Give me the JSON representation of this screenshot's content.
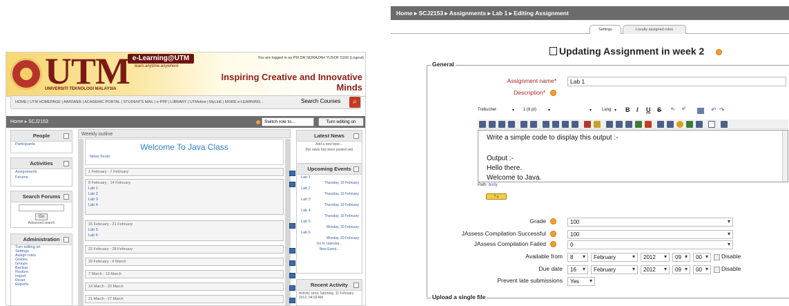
{
  "left": {
    "brand": {
      "name": "UTM",
      "university": "UNIVERSITI TEKNOLOGI MALAYSIA",
      "elearning": "e-Learning@UTM",
      "tagline": "learn.anytime.anywhere",
      "slogan": "Inspiring Creative and Innovative Minds",
      "logged_in": "You are logged in as PM DR NORAZAH YUSOF 5160 (Logout)"
    },
    "nav": {
      "links": "HOME | UTM HOMEPAGE | AIMSWEB | ACADEMIC PORTAL | STUDENTS MAIL | e-PPP | LIBRARY | UTMotion | MyLinE | MORE e-LEARNING...",
      "search_label": "Search Courses"
    },
    "breadcrumb": "Home ▸ SCJ2153",
    "switch_role": "Switch role to...",
    "turn_editing": "Turn editing on",
    "people": {
      "title": "People",
      "items": [
        "Participants"
      ]
    },
    "activities": {
      "title": "Activities",
      "items": [
        "Assignments",
        "Forums"
      ]
    },
    "search_forums": {
      "title": "Search Forums",
      "go": "Go",
      "advanced": "Advanced search"
    },
    "administration": {
      "title": "Administration",
      "items": [
        "Turn editing on",
        "Settings",
        "Assign roles",
        "Grades",
        "Groups",
        "Backup",
        "Restore",
        "Import",
        "Reset",
        "Reports"
      ]
    },
    "outline": {
      "header": "Weekly outline",
      "welcome": "Welcome To Java Class",
      "news_forum": "News forum",
      "weeks": [
        {
          "dates": "1 February - 7 February",
          "items": []
        },
        {
          "dates": "8 February - 14 February",
          "items": [
            "Lab 1",
            "Lab 2",
            "Lab 3",
            "Lab 4"
          ]
        },
        {
          "dates": "15 February - 21 February",
          "items": [
            "Lab 5",
            "Lab 6"
          ]
        },
        {
          "dates": "22 February - 28 February",
          "items": []
        },
        {
          "dates": "29 February - 6 March",
          "items": []
        },
        {
          "dates": "7 March - 13 March",
          "items": []
        },
        {
          "dates": "14 March - 20 March",
          "items": []
        },
        {
          "dates": "21 March - 27 March",
          "items": []
        }
      ]
    },
    "latest_news": {
      "title": "Latest News",
      "add": "Add a new topic...",
      "none": "(No news has been posted yet)"
    },
    "upcoming": {
      "title": "Upcoming Events",
      "events": [
        {
          "name": "Lab 1",
          "date": "Thursday, 16 February"
        },
        {
          "name": "Lab 2",
          "date": "Thursday, 16 February"
        },
        {
          "name": "Lab 3",
          "date": "Thursday, 16 February"
        },
        {
          "name": "Lab 4",
          "date": "Thursday, 16 February"
        },
        {
          "name": "Lab 5",
          "date": "Monday, 20 February"
        },
        {
          "name": "Lab 6",
          "date": "Monday, 20 February"
        }
      ],
      "calendar": "Go to calendar...",
      "new_event": "New Event..."
    },
    "recent": {
      "title": "Recent Activity",
      "since": "Activity since Saturday, 11 February 2012, 04:02 AM"
    }
  },
  "right": {
    "breadcrumb": "Home ▸ SCJ2153 ▸ Assignments ▸ Lab 1 ▸ Editing Assignment",
    "tabs": [
      "Settings",
      "Locally assigned roles"
    ],
    "title": "Updating Assignment in week 2",
    "general_legend": "General",
    "assignment_name_label": "Assignment name",
    "assignment_name_value": "Lab 1",
    "description_label": "Description",
    "toolbar": {
      "font": "Trebuchet",
      "size": "1 (8 pt)",
      "lang": "Lang"
    },
    "editor_lines": [
      "Write a simple code to display this output :-",
      "",
      "Output :-",
      "Hello there.",
      "Welcome to Java."
    ],
    "path_label": "Path:",
    "path_value": "body",
    "fields": [
      {
        "label": "Grade",
        "value": "100"
      },
      {
        "label": "JAssess Compilation Successful",
        "value": "100"
      },
      {
        "label": "JAssess Compilation Failed",
        "value": "0"
      }
    ],
    "available_from": {
      "label": "Available from",
      "day": "8",
      "month": "February",
      "year": "2012",
      "hour": "09",
      "minute": "00",
      "disable": "Disable"
    },
    "due_date": {
      "label": "Due date",
      "day": "16",
      "month": "February",
      "year": "2012",
      "hour": "09",
      "minute": "00",
      "disable": "Disable"
    },
    "prevent_late": {
      "label": "Prevent late submissions",
      "value": "Yes"
    },
    "upload_legend": "Upload a single file"
  }
}
